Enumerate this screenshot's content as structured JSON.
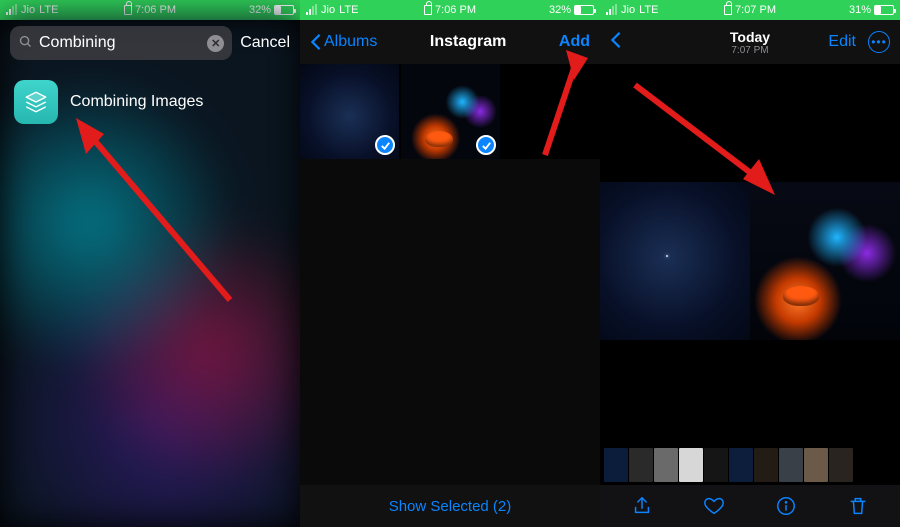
{
  "colors": {
    "accent": "#0a84ff",
    "status_green": "#2fd158",
    "arrow": "#e21b1b"
  },
  "phone1": {
    "status": {
      "carrier": "Jio",
      "network": "LTE",
      "time": "7:06 PM",
      "battery_pct": "32%",
      "battery_fill": 32
    },
    "search": {
      "query": "Combining",
      "cancel": "Cancel"
    },
    "result": {
      "title": "Combining Images",
      "icon_name": "layers-icon"
    }
  },
  "phone2": {
    "nav": {
      "back": "Albums",
      "title": "Instagram",
      "action": "Add"
    },
    "selected_count": 2,
    "footer": "Show Selected (2)"
  },
  "phone3": {
    "status": {
      "carrier": "Jio",
      "network": "LTE",
      "time": "7:07 PM",
      "battery_pct": "31%",
      "battery_fill": 31
    },
    "nav": {
      "title": "Today",
      "subtitle": "7:07 PM",
      "edit": "Edit"
    },
    "filmstrip_colors": [
      "#0b1d3a",
      "#2a2a2a",
      "#6a6a6a",
      "#d7d7d7",
      "#151515",
      "#0c1e3c",
      "#221c14",
      "#394048",
      "#6c5a48",
      "#2a2420"
    ]
  }
}
